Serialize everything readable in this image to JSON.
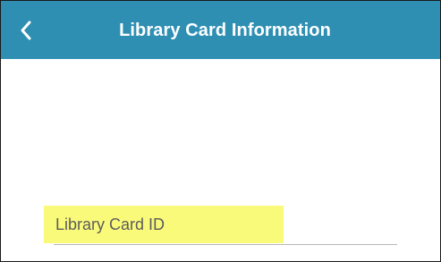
{
  "header": {
    "title": "Library Card Information",
    "back_icon": "chevron-left-icon",
    "background_color": "#2f8fb3",
    "text_color": "#ffffff"
  },
  "form": {
    "card_id": {
      "placeholder": "Library Card ID",
      "value": "",
      "highlight_color": "#fafa7a"
    }
  }
}
